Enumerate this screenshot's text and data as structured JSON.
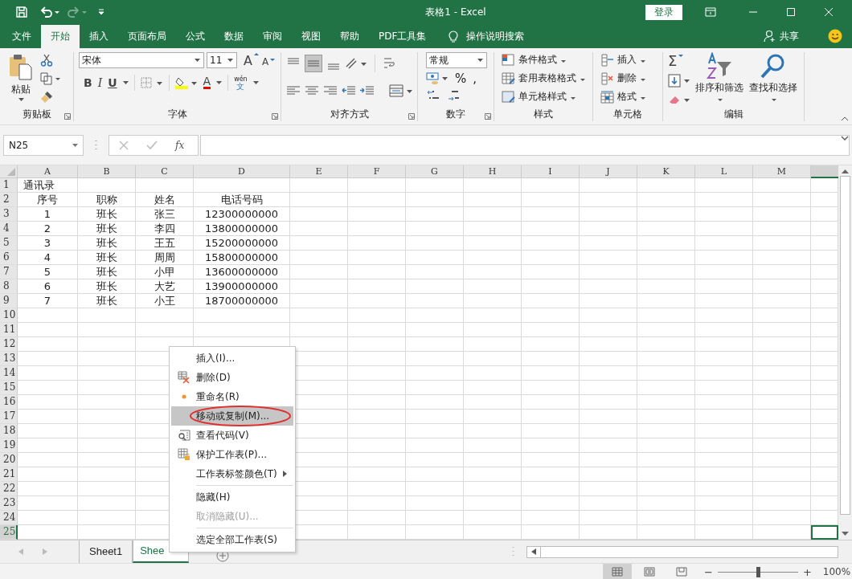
{
  "window": {
    "title": "表格1  -  Excel",
    "sign_in": "登录"
  },
  "ribbon_tabs": [
    {
      "label": "文件",
      "selected": false
    },
    {
      "label": "开始",
      "selected": true
    },
    {
      "label": "插入",
      "selected": false
    },
    {
      "label": "页面布局",
      "selected": false
    },
    {
      "label": "公式",
      "selected": false
    },
    {
      "label": "数据",
      "selected": false
    },
    {
      "label": "审阅",
      "selected": false
    },
    {
      "label": "视图",
      "selected": false
    },
    {
      "label": "帮助",
      "selected": false
    },
    {
      "label": "PDF工具集",
      "selected": false
    }
  ],
  "tell_me": "操作说明搜索",
  "share": "共享",
  "ribbon": {
    "clipboard": {
      "label": "剪贴板",
      "paste": "粘贴",
      "launcher": true
    },
    "font": {
      "label": "字体",
      "font_name": "宋体",
      "font_size": "11",
      "grow": "A",
      "shrink": "A",
      "bold": "B",
      "italic": "I",
      "underline": "U",
      "font_color": "A",
      "phonetic": "wén",
      "phonetic_sub": "文",
      "launcher": true
    },
    "alignment": {
      "label": "对齐方式",
      "launcher": true
    },
    "number": {
      "label": "数字",
      "format": "常规",
      "percent": "%",
      "comma": ",",
      "launcher": true
    },
    "styles": {
      "label": "样式",
      "items": [
        "条件格式",
        "套用表格格式",
        "单元格样式"
      ],
      "launcher": false
    },
    "cells": {
      "label": "单元格",
      "items": [
        "插入",
        "删除",
        "格式"
      ],
      "launcher": false
    },
    "editing": {
      "label": "编辑",
      "sigma": "Σ",
      "items": [
        "排序和筛选",
        "查找和选择"
      ],
      "launcher": false
    }
  },
  "formula_bar": {
    "name_box": "N25",
    "function_label": "fx"
  },
  "sheet": {
    "columns": [
      "A",
      "B",
      "C",
      "D",
      "E",
      "F",
      "G",
      "H",
      "I",
      "J",
      "K",
      "L",
      "M"
    ],
    "rows": [
      {
        "number": "1",
        "selected": false,
        "cells": [
          "通讯录"
        ]
      },
      {
        "number": "2",
        "selected": false,
        "cells": [
          "序号",
          "职称",
          "姓名",
          "电话号码"
        ]
      },
      {
        "number": "3",
        "selected": false,
        "cells": [
          "1",
          "班长",
          "张三",
          "12300000000"
        ]
      },
      {
        "number": "4",
        "selected": false,
        "cells": [
          "2",
          "班长",
          "李四",
          "13800000000"
        ]
      },
      {
        "number": "5",
        "selected": false,
        "cells": [
          "3",
          "班长",
          "王五",
          "15200000000"
        ]
      },
      {
        "number": "6",
        "selected": false,
        "cells": [
          "4",
          "班长",
          "周周",
          "15800000000"
        ]
      },
      {
        "number": "7",
        "selected": false,
        "cells": [
          "5",
          "班长",
          "小甲",
          "13600000000"
        ]
      },
      {
        "number": "8",
        "selected": false,
        "cells": [
          "6",
          "班长",
          "大艺",
          "13900000000"
        ]
      },
      {
        "number": "9",
        "selected": false,
        "cells": [
          "7",
          "班长",
          "小王",
          "18700000000"
        ]
      },
      {
        "number": "10",
        "selected": false,
        "cells": []
      },
      {
        "number": "11",
        "selected": false,
        "cells": []
      },
      {
        "number": "12",
        "selected": false,
        "cells": []
      },
      {
        "number": "13",
        "selected": false,
        "cells": []
      },
      {
        "number": "14",
        "selected": false,
        "cells": []
      },
      {
        "number": "15",
        "selected": false,
        "cells": []
      },
      {
        "number": "16",
        "selected": false,
        "cells": []
      },
      {
        "number": "17",
        "selected": false,
        "cells": []
      },
      {
        "number": "18",
        "selected": false,
        "cells": []
      },
      {
        "number": "19",
        "selected": false,
        "cells": []
      },
      {
        "number": "20",
        "selected": false,
        "cells": []
      },
      {
        "number": "21",
        "selected": false,
        "cells": []
      },
      {
        "number": "22",
        "selected": false,
        "cells": []
      },
      {
        "number": "23",
        "selected": false,
        "cells": []
      },
      {
        "number": "24",
        "selected": false,
        "cells": []
      },
      {
        "number": "25",
        "selected": true,
        "cells": []
      }
    ]
  },
  "sheet_tabs": [
    {
      "label": "Sheet1",
      "selected": false
    },
    {
      "label": "Shee",
      "selected": true
    }
  ],
  "context_menu": [
    {
      "label": "插入(I)...",
      "kind": "none",
      "selected": false,
      "disabled": false,
      "submenu": false,
      "separator_before": false,
      "circled": false
    },
    {
      "label": "删除(D)",
      "kind": "delete",
      "selected": false,
      "disabled": false,
      "submenu": false,
      "separator_before": false,
      "circled": false
    },
    {
      "label": "重命名(R)",
      "kind": "dot",
      "selected": false,
      "disabled": false,
      "submenu": false,
      "separator_before": false,
      "circled": false
    },
    {
      "label": "移动或复制(M)...",
      "kind": "none",
      "selected": true,
      "disabled": false,
      "submenu": false,
      "separator_before": false,
      "circled": true
    },
    {
      "label": "查看代码(V)",
      "kind": "code",
      "selected": false,
      "disabled": false,
      "submenu": false,
      "separator_before": false,
      "circled": false
    },
    {
      "label": "保护工作表(P)...",
      "kind": "lock",
      "selected": false,
      "disabled": false,
      "submenu": false,
      "separator_before": false,
      "circled": false
    },
    {
      "label": "工作表标签颜色(T)",
      "kind": "none",
      "selected": false,
      "disabled": false,
      "submenu": true,
      "separator_before": false,
      "circled": false
    },
    {
      "label": "隐藏(H)",
      "kind": "none",
      "selected": false,
      "disabled": false,
      "submenu": false,
      "separator_before": true,
      "circled": false
    },
    {
      "label": "取消隐藏(U)...",
      "kind": "none",
      "selected": false,
      "disabled": true,
      "submenu": false,
      "separator_before": false,
      "circled": false
    },
    {
      "label": "选定全部工作表(S)",
      "kind": "none",
      "selected": false,
      "disabled": false,
      "submenu": false,
      "separator_before": true,
      "circled": false
    }
  ],
  "status_bar": {
    "views": [
      {
        "kind": "normal",
        "selected": true
      },
      {
        "kind": "layout",
        "selected": false
      },
      {
        "kind": "break",
        "selected": false
      }
    ],
    "zoom_out": "−",
    "zoom_in": "+",
    "zoom": {
      "level": 0.5
    },
    "zoom_label": "100%"
  }
}
